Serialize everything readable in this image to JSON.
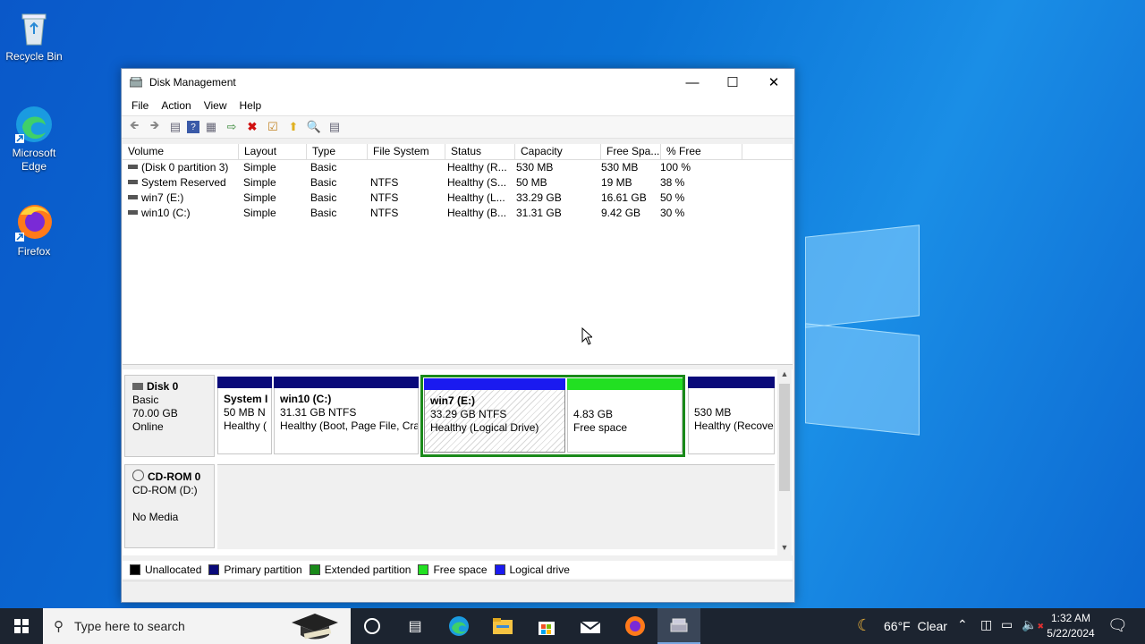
{
  "desktop": {
    "icons": [
      {
        "label": "Recycle Bin"
      },
      {
        "label": "Microsoft\nEdge"
      },
      {
        "label": "Firefox"
      }
    ]
  },
  "window": {
    "title": "Disk Management",
    "menu": [
      "File",
      "Action",
      "View",
      "Help"
    ],
    "list": {
      "columns": [
        "Volume",
        "Layout",
        "Type",
        "File System",
        "Status",
        "Capacity",
        "Free Spa...",
        "% Free"
      ],
      "rows": [
        [
          "(Disk 0 partition 3)",
          "Simple",
          "Basic",
          "",
          "Healthy (R...",
          "530 MB",
          "530 MB",
          "100 %"
        ],
        [
          "System Reserved",
          "Simple",
          "Basic",
          "NTFS",
          "Healthy (S...",
          "50 MB",
          "19 MB",
          "38 %"
        ],
        [
          "win7 (E:)",
          "Simple",
          "Basic",
          "NTFS",
          "Healthy (L...",
          "33.29 GB",
          "16.61 GB",
          "50 %"
        ],
        [
          "win10 (C:)",
          "Simple",
          "Basic",
          "NTFS",
          "Healthy (B...",
          "31.31 GB",
          "9.42 GB",
          "30 %"
        ]
      ]
    },
    "disks": [
      {
        "name": "Disk 0",
        "line1": "Basic",
        "line2": "70.00 GB",
        "line3": "Online"
      },
      {
        "name": "CD-ROM 0",
        "line1": "CD-ROM (D:)",
        "line2": "",
        "line3": "No Media"
      }
    ],
    "partitions": [
      {
        "title": "System I",
        "size": "50 MB N",
        "status": "Healthy (",
        "kind": "primary"
      },
      {
        "title": "win10  (C:)",
        "size": "31.31 GB NTFS",
        "status": "Healthy (Boot, Page File, Cra",
        "kind": "primary"
      },
      {
        "title": "win7  (E:)",
        "size": "33.29 GB NTFS",
        "status": "Healthy (Logical Drive)",
        "kind": "logical"
      },
      {
        "title": "",
        "size": "4.83 GB",
        "status": "Free space",
        "kind": "free"
      },
      {
        "title": "",
        "size": "530 MB",
        "status": "Healthy (Recove",
        "kind": "primary"
      }
    ],
    "legend": [
      {
        "label": "Unallocated",
        "color": "#000000"
      },
      {
        "label": "Primary partition",
        "color": "#0a0a7a"
      },
      {
        "label": "Extended partition",
        "color": "#1a8a1a"
      },
      {
        "label": "Free space",
        "color": "#22e022"
      },
      {
        "label": "Logical drive",
        "color": "#1a1af0"
      }
    ]
  },
  "taskbar": {
    "search_placeholder": "Type here to search",
    "weather": "66°F  Clear",
    "time": "1:32 AM",
    "date": "5/22/2024"
  },
  "colors": {
    "primary": "#0a0a7a",
    "logical": "#1a1af0",
    "free": "#22e022",
    "extended_border": "#1a8a1a"
  }
}
